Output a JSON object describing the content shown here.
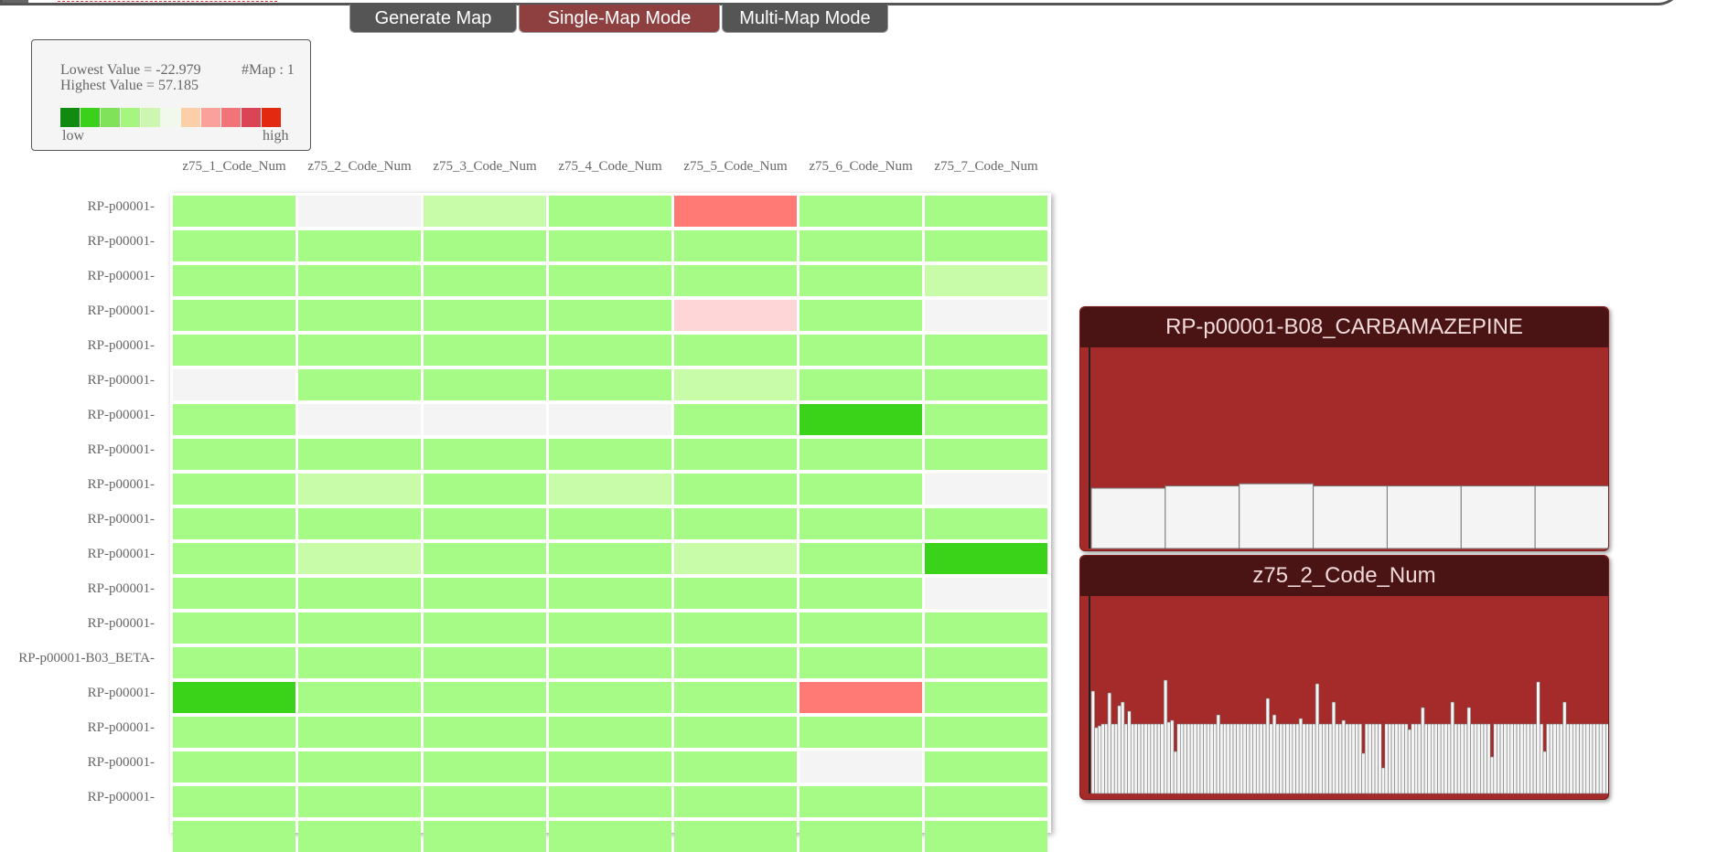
{
  "toolbar": {
    "generate_label": "Generate Map",
    "single_label": "Single-Map Mode",
    "multi_label": "Multi-Map Mode"
  },
  "legend": {
    "lowest": "Lowest Value = -22.979",
    "highest": "Highest Value = 57.185",
    "map_count": "#Map : 1",
    "low_label": "low",
    "high_label": "high",
    "swatch_colors": [
      "#118a11",
      "#3bd11a",
      "#7fe25a",
      "#a6f57f",
      "#cdf6b1",
      "#f1f8ec",
      "#fbd0a8",
      "#f9a19a",
      "#f07478",
      "#d94555",
      "#e32a10"
    ]
  },
  "columns": [
    "z75_1_Code_Num",
    "z75_2_Code_Num",
    "z75_3_Code_Num",
    "z75_4_Code_Num",
    "z75_5_Code_Num",
    "z75_6_Code_Num",
    "z75_7_Code_Num"
  ],
  "rows": [
    "RP-p00001-",
    "RP-p00001-",
    "RP-p00001-",
    "RP-p00001-",
    "RP-p00001-",
    "RP-p00001-",
    "RP-p00001-",
    "RP-p00001-",
    "RP-p00001-",
    "RP-p00001-",
    "RP-p00001-",
    "RP-p00001-",
    "RP-p00001-",
    "RP-p00001-B03_BETA-",
    "RP-p00001-",
    "RP-p00001-",
    "RP-p00001-",
    "RP-p00001-"
  ],
  "cell_colors": {
    "G": "#a6fb86",
    "L": "#c9fca8",
    "W": "#f4f4f4",
    "D": "#3bd31a",
    "R": "#ff7a75",
    "P": "#ffd6d8"
  },
  "grid": [
    [
      "G",
      "W",
      "L",
      "G",
      "R",
      "G",
      "G"
    ],
    [
      "G",
      "G",
      "G",
      "G",
      "G",
      "G",
      "G"
    ],
    [
      "G",
      "G",
      "G",
      "G",
      "G",
      "G",
      "L"
    ],
    [
      "G",
      "G",
      "G",
      "G",
      "P",
      "G",
      "W"
    ],
    [
      "G",
      "G",
      "G",
      "G",
      "G",
      "G",
      "G"
    ],
    [
      "W",
      "G",
      "G",
      "G",
      "L",
      "G",
      "G"
    ],
    [
      "G",
      "W",
      "W",
      "W",
      "G",
      "D",
      "G"
    ],
    [
      "G",
      "G",
      "G",
      "G",
      "G",
      "G",
      "G"
    ],
    [
      "G",
      "L",
      "G",
      "L",
      "G",
      "G",
      "W"
    ],
    [
      "G",
      "G",
      "G",
      "G",
      "G",
      "G",
      "G"
    ],
    [
      "G",
      "L",
      "G",
      "G",
      "L",
      "G",
      "D"
    ],
    [
      "G",
      "G",
      "G",
      "G",
      "G",
      "G",
      "W"
    ],
    [
      "G",
      "G",
      "G",
      "G",
      "G",
      "G",
      "G"
    ],
    [
      "G",
      "G",
      "G",
      "G",
      "G",
      "G",
      "G"
    ],
    [
      "D",
      "G",
      "G",
      "G",
      "G",
      "R",
      "G"
    ],
    [
      "G",
      "G",
      "G",
      "G",
      "G",
      "G",
      "G"
    ],
    [
      "G",
      "G",
      "G",
      "G",
      "G",
      "W",
      "G"
    ],
    [
      "G",
      "G",
      "G",
      "G",
      "G",
      "G",
      "G"
    ],
    [
      "G",
      "G",
      "G",
      "G",
      "G",
      "G",
      "G"
    ]
  ],
  "row_panel": {
    "title": "RP-p00001-B08_CARBAMAZEPINE",
    "bar_values": [
      0.55,
      0.57,
      0.59,
      0.57,
      0.57,
      0.57,
      0.57
    ]
  },
  "col_panel": {
    "title": "z75_2_Code_Num",
    "bar_values": [
      0.56,
      0.36,
      0.37,
      0.37,
      0.38,
      0.38,
      0.38,
      0.38,
      0.39,
      0.38,
      0.38,
      0.38,
      0.38,
      0.38,
      0.38,
      0.38,
      0.38,
      0.38,
      0.38,
      0.38,
      0.38,
      0.38,
      0.38,
      0.39,
      0.38,
      0.38,
      0.38,
      0.38,
      0.38,
      0.38,
      0.38,
      0.38,
      0.38,
      0.38,
      0.38,
      0.38,
      0.38,
      0.38,
      0.38,
      0.38,
      0.38,
      0.38,
      0.38,
      0.38,
      0.38,
      0.38,
      0.38,
      0.38,
      0.38,
      0.38,
      0.38,
      0.38,
      0.38,
      0.38,
      0.38,
      0.38,
      0.38,
      0.38,
      0.38,
      0.38,
      0.38,
      0.38,
      0.38,
      0.38,
      0.38,
      0.38,
      0.38,
      0.38,
      0.38,
      0.38,
      0.38,
      0.38,
      0.38,
      0.38,
      0.38,
      0.38,
      0.38,
      0.38,
      0.38,
      0.38,
      0.38,
      0.38,
      0.38,
      0.38,
      0.38,
      0.38,
      0.38,
      0.38,
      0.38,
      0.38,
      0.38,
      0.38,
      0.38,
      0.38,
      0.38,
      0.38,
      0.38,
      0.38,
      0.38,
      0.38,
      0.38,
      0.38,
      0.38,
      0.38,
      0.38,
      0.38,
      0.38,
      0.38,
      0.38,
      0.38,
      0.38,
      0.38,
      0.38,
      0.38,
      0.38,
      0.38,
      0.38,
      0.38,
      0.38,
      0.38,
      0.38,
      0.38,
      0.38,
      0.38,
      0.38,
      0.38,
      0.38,
      0.38,
      0.38,
      0.38,
      0.38,
      0.38,
      0.38,
      0.38,
      0.38,
      0.38,
      0.38,
      0.38,
      0.38,
      0.38,
      0.38,
      0.38,
      0.38,
      0.38,
      0.38,
      0.38,
      0.38,
      0.38,
      0.38,
      0.38,
      0.38,
      0.38,
      0.38,
      0.38,
      0.38,
      0.38,
      0.38
    ],
    "peaks": {
      "0": 0.56,
      "3": 0.38,
      "5": 0.55,
      "8": 0.48,
      "9": 0.5,
      "11": 0.45,
      "22": 0.62,
      "24": 0.4,
      "25": 0.23,
      "38": 0.43,
      "53": 0.52,
      "55": 0.43,
      "63": 0.41,
      "68": 0.6,
      "73": 0.5,
      "76": 0.4,
      "82": 0.22,
      "88": 0.14,
      "96": 0.35,
      "100": 0.47,
      "109": 0.5,
      "114": 0.47,
      "121": 0.2,
      "135": 0.61,
      "137": 0.23,
      "139": 0.38,
      "143": 0.5
    }
  }
}
